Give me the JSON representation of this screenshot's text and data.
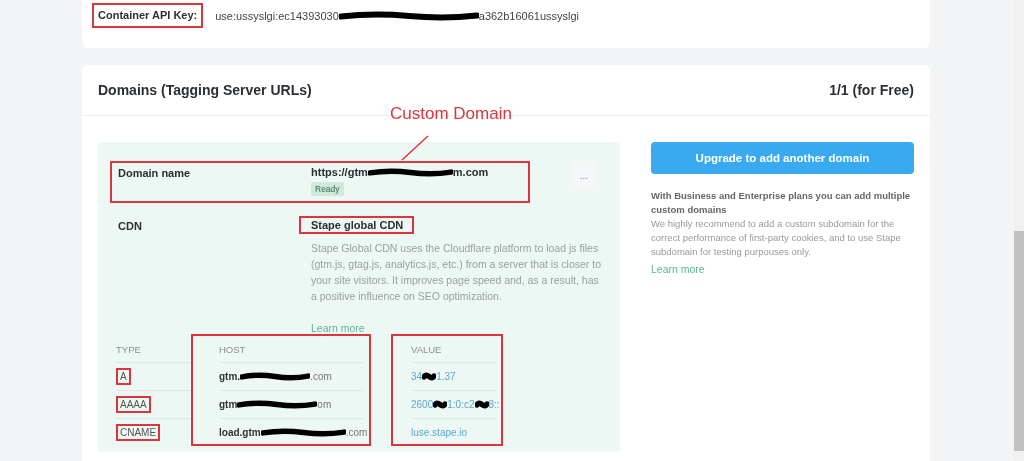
{
  "api_key": {
    "label": "Container API Key:",
    "highlighted": true,
    "value_parts": [
      "use:ussyslgi:ec14393030",
      "a362b16061ussyslgi"
    ]
  },
  "domains": {
    "title": "Domains (Tagging Server URLs)",
    "quota": "1/1 (for Free)",
    "annotation": "Custom Domain",
    "domain_name": {
      "label": "Domain name",
      "value_parts": [
        "https://gtm",
        "m.com"
      ],
      "status": "Ready",
      "highlighted": true,
      "menu": "..."
    },
    "cdn": {
      "label": "CDN",
      "value": "Stape global CDN",
      "highlighted": true,
      "description": "Stape Global CDN uses the Cloudflare platform to load js files (gtm.js, gtag.js, analytics.js, etc.) from a server that is closer to your site visitors. It improves page speed and, as a result, has a positive influence on SEO optimization.",
      "link": "Learn more"
    },
    "table": {
      "columns": [
        {
          "title": "TYPE",
          "highlighted": false
        },
        {
          "title": "HOST",
          "highlighted": true
        },
        {
          "title": "VALUE",
          "highlighted": true
        }
      ],
      "rows": [
        {
          "type": "A",
          "type_highlighted": true,
          "host_parts": [
            "gtm.",
            ".com"
          ],
          "value_parts": [
            "34",
            "1.37"
          ]
        },
        {
          "type": "AAAA",
          "type_highlighted": true,
          "host_parts": [
            "gtm",
            "om"
          ],
          "value_parts": [
            "2600",
            "1:0:c2",
            "8::"
          ]
        },
        {
          "type": "CNAME",
          "type_highlighted": true,
          "host_parts": [
            "load.gtm",
            ".com"
          ],
          "value_parts": [
            "luse.stape.io"
          ]
        }
      ]
    }
  },
  "upgrade": {
    "button": "Upgrade to add another domain",
    "note_title": "With Business and Enterprise plans you can add multiple custom domains",
    "note": "We highly recommend to add a custom subdomain for the correct performance of first-party cookies, and to use Stape subdomain for testing purpouses only.",
    "link": "Learn more"
  }
}
